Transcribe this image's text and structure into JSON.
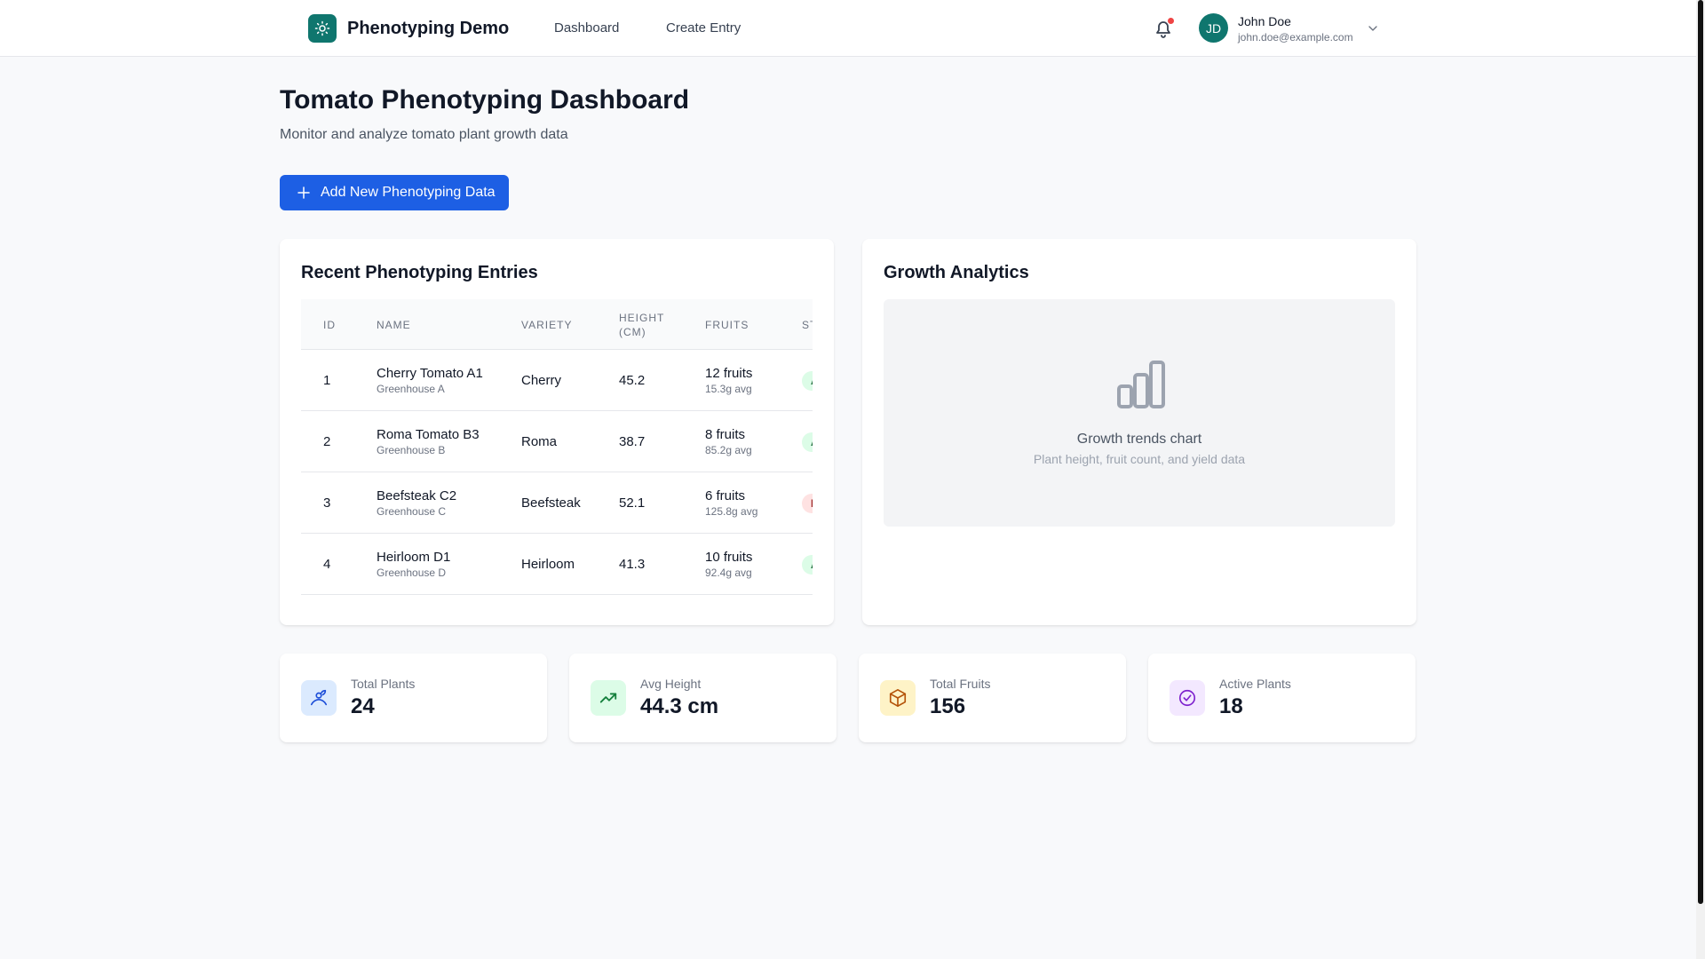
{
  "colors": {
    "brand": "#0f766e",
    "primary_button": "#1d5fe4",
    "notification_dot": "#ef4444",
    "status_green_bg": "#dcfce7",
    "status_red_bg": "#fee2e2"
  },
  "header": {
    "app_name": "Phenotyping Demo",
    "logo_icon": "sun-icon",
    "nav": [
      {
        "label": "Dashboard"
      },
      {
        "label": "Create Entry"
      }
    ],
    "notification_icon": "bell-icon",
    "user": {
      "initials": "JD",
      "name": "John Doe",
      "email": "john.doe@example.com",
      "menu_icon": "chevron-down-icon"
    }
  },
  "page": {
    "title": "Tomato Phenotyping Dashboard",
    "subtitle": "Monitor and analyze tomato plant growth data",
    "add_button": {
      "label": "Add New Phenotyping Data",
      "icon": "plus-icon"
    }
  },
  "entries": {
    "title": "Recent Phenotyping Entries",
    "columns": [
      "ID",
      "NAME",
      "VARIETY",
      "HEIGHT (CM)",
      "FRUITS",
      "ST"
    ],
    "rows": [
      {
        "id": "1",
        "name": "Cherry Tomato A1",
        "location": "Greenhouse A",
        "variety": "Cherry",
        "height": "45.2",
        "fruits": "12 fruits",
        "fruit_avg": "15.3g avg",
        "status": "A",
        "status_color": "green"
      },
      {
        "id": "2",
        "name": "Roma Tomato B3",
        "location": "Greenhouse B",
        "variety": "Roma",
        "height": "38.7",
        "fruits": "8 fruits",
        "fruit_avg": "85.2g avg",
        "status": "A",
        "status_color": "green"
      },
      {
        "id": "3",
        "name": "Beefsteak C2",
        "location": "Greenhouse C",
        "variety": "Beefsteak",
        "height": "52.1",
        "fruits": "6 fruits",
        "fruit_avg": "125.8g avg",
        "status": "I",
        "status_color": "red"
      },
      {
        "id": "4",
        "name": "Heirloom D1",
        "location": "Greenhouse D",
        "variety": "Heirloom",
        "height": "41.3",
        "fruits": "10 fruits",
        "fruit_avg": "92.4g avg",
        "status": "A",
        "status_color": "green"
      }
    ]
  },
  "analytics": {
    "title": "Growth Analytics",
    "placeholder_icon": "bar-chart-icon",
    "placeholder_title": "Growth trends chart",
    "placeholder_subtitle": "Plant height, fruit count, and yield data"
  },
  "stats": [
    {
      "label": "Total Plants",
      "value": "24",
      "icon": "plant-icon",
      "color": "#dbeafe"
    },
    {
      "label": "Avg Height",
      "value": "44.3 cm",
      "icon": "trending-up-icon",
      "color": "#dcfce7"
    },
    {
      "label": "Total Fruits",
      "value": "156",
      "icon": "box-icon",
      "color": "#fef3c7"
    },
    {
      "label": "Active Plants",
      "value": "18",
      "icon": "check-circle-icon",
      "color": "#f3e8ff"
    }
  ]
}
